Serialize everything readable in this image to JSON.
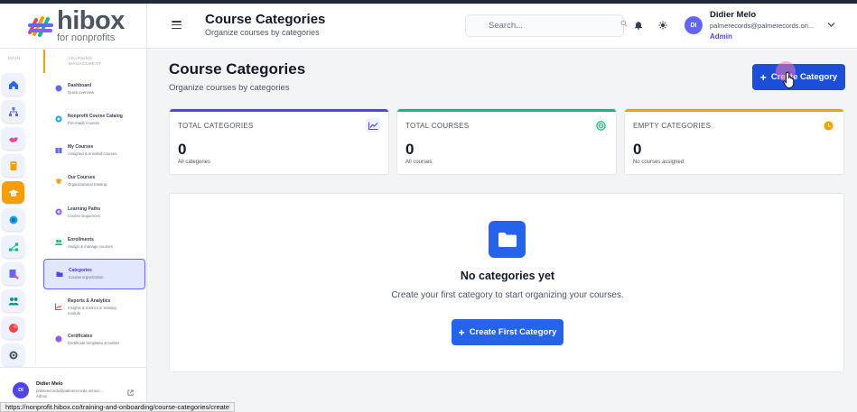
{
  "brand": {
    "name": "hibox",
    "tagline": "for nonprofits"
  },
  "rail": {
    "label": "MAIN",
    "icons": [
      "home-icon",
      "org-chart-icon",
      "handshake-icon",
      "book-icon",
      "graduation-cap-icon",
      "globe-icon",
      "network-icon",
      "certificate-icon",
      "users-icon",
      "pie-chart-icon",
      "gear-icon"
    ]
  },
  "menu": {
    "header_line1": "LEARNING",
    "header_line2": "MANAGEMENT",
    "items": [
      {
        "title": "Dashboard",
        "sub": "Quick overview",
        "icon": "dashboard-icon",
        "color": "#6366f1"
      },
      {
        "title": "Nonprofit Course Catalog",
        "sub": "Pre-made courses",
        "icon": "catalog-icon",
        "color": "#0ea5e9"
      },
      {
        "title": "My Courses",
        "sub": "Assigned & enrolled courses",
        "icon": "book-icon",
        "color": "#6366f1"
      },
      {
        "title": "Our Courses",
        "sub": "Organizational training",
        "icon": "graduation-cap-icon",
        "color": "#f59e0b"
      },
      {
        "title": "Learning Paths",
        "sub": "Course sequences",
        "icon": "path-icon",
        "color": "#8b5cf6"
      },
      {
        "title": "Enrollments",
        "sub": "Assign & manage courses",
        "icon": "users-icon",
        "color": "#10b981"
      },
      {
        "title": "Categories",
        "sub": "Course organization",
        "icon": "folder-icon",
        "color": "#4f46e5"
      },
      {
        "title": "Reports & Analytics",
        "sub": "Insights & metrics in training",
        "sub2": "module",
        "icon": "chart-icon",
        "color": "#ef4444"
      },
      {
        "title": "Certificates",
        "sub": "Certificate templates & builder",
        "icon": "certificate-icon",
        "color": "#8b5cf6"
      }
    ]
  },
  "sidebar_user": {
    "initials": "DI",
    "name": "Didier Melo",
    "email": "palmerecords@palmerecords.onmicr...",
    "role": "Admin"
  },
  "topbar": {
    "title": "Course Categories",
    "subtitle": "Organize courses by categories",
    "search_placeholder": "Search...",
    "user_initials": "DI",
    "user_name": "Didier Melo",
    "user_email": "palmerecords@palmerecords.on...",
    "user_role": "Admin"
  },
  "page": {
    "title": "Course Categories",
    "subtitle": "Organize courses by categories",
    "create_label": "Create Category"
  },
  "stats": [
    {
      "label": "TOTAL CATEGORIES",
      "value": "0",
      "desc": "All categories",
      "accent": "#4f46e5",
      "icon": "trend-icon"
    },
    {
      "label": "TOTAL COURSES",
      "value": "0",
      "desc": "All courses",
      "accent": "#10b981",
      "icon": "target-icon"
    },
    {
      "label": "EMPTY CATEGORIES",
      "value": "0",
      "desc": "No courses assigned",
      "accent": "#f59e0b",
      "icon": "clock-icon"
    }
  ],
  "empty": {
    "title": "No categories yet",
    "subtitle": "Create your first category to start organizing your courses.",
    "button_label": "Create First Category"
  },
  "status_bar_url": "https://nonprofit.hibox.co/training-and-onboarding/course-categories/create"
}
